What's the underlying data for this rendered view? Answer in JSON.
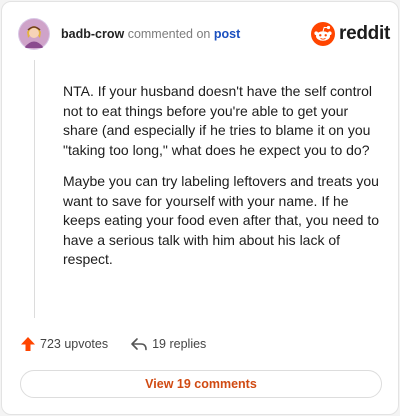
{
  "comment": {
    "username": "badb-crow",
    "action_text": "commented on",
    "post_link": "post",
    "paragraphs": [
      "NTA. If your husband doesn't have the self control not to eat things before you're able to get your share (and especially if he tries to blame it on you \"taking too long,\" what does he expect you to do?",
      "Maybe you can try labeling leftovers and treats you want to save for yourself with your name. If he keeps eating your food even after that, you need to have a serious talk with him about his lack of respect."
    ]
  },
  "brand": {
    "wordmark": "reddit",
    "icon": "reddit-snoo-icon",
    "color": "#ff4500"
  },
  "stats": {
    "upvotes": "723 upvotes",
    "upvote_icon": "upvote-arrow-icon",
    "upvote_color": "#ff4500",
    "replies": "19 replies",
    "reply_icon": "reply-arrow-icon"
  },
  "actions": {
    "view_comments": "View 19 comments",
    "view_color": "#d04a12"
  }
}
